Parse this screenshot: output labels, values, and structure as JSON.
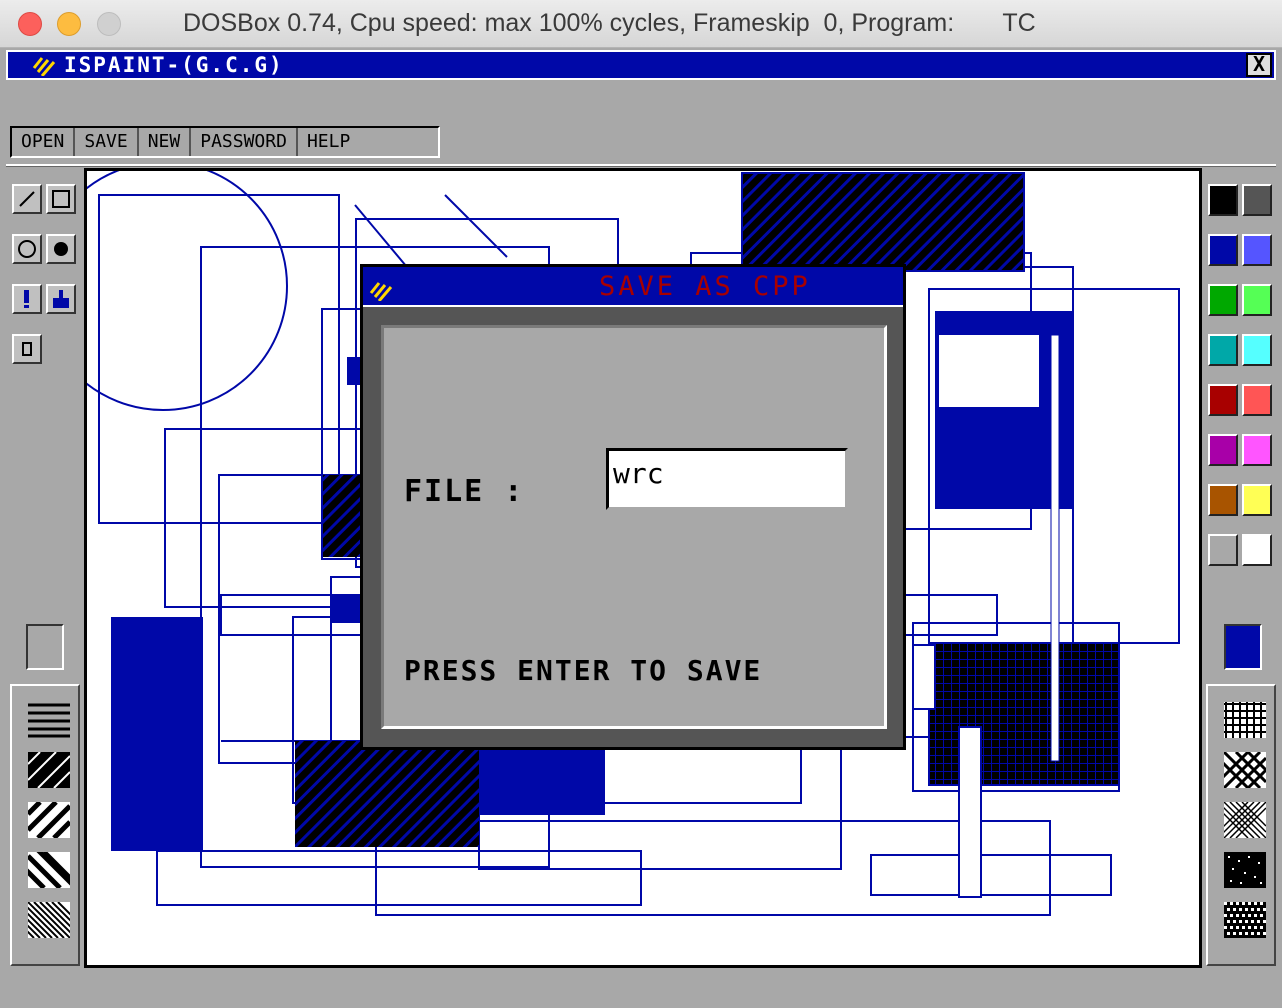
{
  "window": {
    "title": "DOSBox 0.74, Cpu speed: max 100% cycles, Frameskip  0, Program:       TC"
  },
  "app": {
    "title": "ISPAINT-(G.C.G)",
    "close_label": "X"
  },
  "menu": {
    "items": [
      "OPEN",
      "SAVE",
      "NEW",
      "PASSWORD",
      "HELP"
    ]
  },
  "tools": [
    "line-tool",
    "rectangle-tool",
    "circle-tool",
    "filled-circle-tool",
    "spray-tool",
    "fill-tool",
    "eraser-tool"
  ],
  "palette": {
    "colors": [
      "#000000",
      "#555555",
      "#0008a8",
      "#5555ff",
      "#00a800",
      "#55ff55",
      "#00a8a8",
      "#55ffff",
      "#a80000",
      "#ff5555",
      "#a800a8",
      "#ff55ff",
      "#a85400",
      "#ffff55",
      "#a8a8a8",
      "#ffffff"
    ],
    "current_color": "#0008a8"
  },
  "dialog": {
    "title": "SAVE AS CPP",
    "file_label": "FILE :",
    "file_value": "wrc",
    "hint": "PRESS ENTER TO SAVE"
  },
  "colors": {
    "dos_blue": "#0008a8",
    "dos_gray": "#a8a8a8",
    "dialog_title": "#a80000"
  }
}
